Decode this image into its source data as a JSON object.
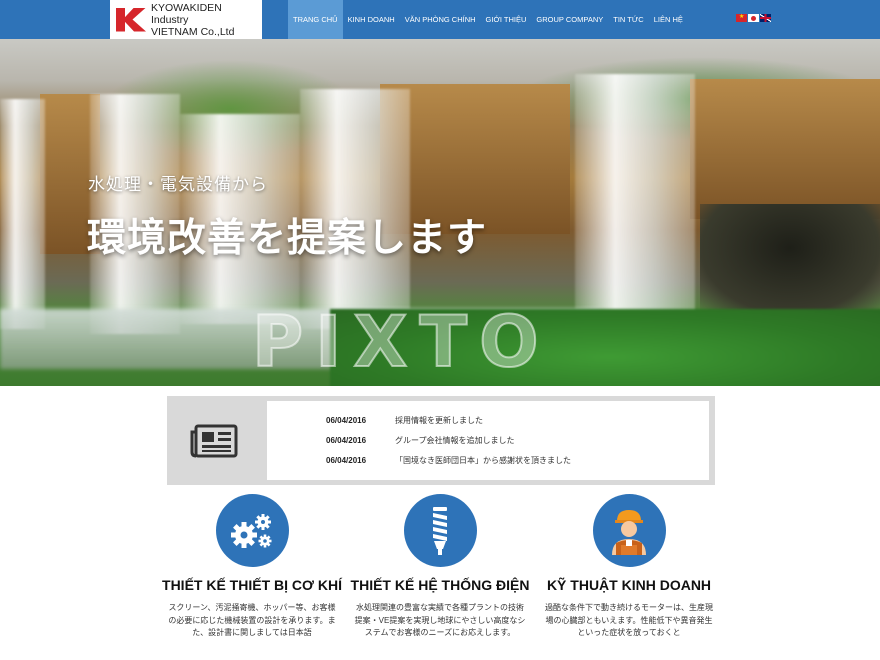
{
  "header": {
    "logo_line1": "KYOWAKIDEN Industry",
    "logo_line2": "VIETNAM Co.,Ltd",
    "nav": [
      {
        "label": "TRANG CHỦ",
        "active": true
      },
      {
        "label": "KINH DOANH",
        "active": false
      },
      {
        "label": "VĂN PHÒNG CHÍNH",
        "active": false
      },
      {
        "label": "GIỚI THIỆU",
        "active": false
      },
      {
        "label": "GROUP COMPANY",
        "active": false
      },
      {
        "label": "TIN TỨC",
        "active": false
      },
      {
        "label": "LIÊN HỆ",
        "active": false
      }
    ],
    "flags": [
      "vietnam-flag-icon",
      "japan-flag-icon",
      "uk-flag-icon"
    ]
  },
  "hero": {
    "subtitle": "水処理・電気設備から",
    "title": "環境改善を提案します",
    "watermark": "PIXTO"
  },
  "news": {
    "icon": "newspaper-icon",
    "items": [
      {
        "date": "06/04/2016",
        "text": "採用情報を更新しました"
      },
      {
        "date": "06/04/2016",
        "text": "グループ会社情報を追加しました"
      },
      {
        "date": "06/04/2016",
        "text": "「国境なき医師団日本」から感謝状を頂きました"
      }
    ]
  },
  "services": [
    {
      "icon": "gears-icon",
      "title": "THIẾT KẾ THIẾT BỊ CƠ KHÍ",
      "desc": "スクリーン、汚泥掻寄機、ホッパー等、お客様の必要に応じた機械装置の設計を承ります。また、設計書に関しましては日本語"
    },
    {
      "icon": "light-bulb-icon",
      "title": "THIẾT KẾ HỆ THỐNG ĐIỆN",
      "desc": "水処理関連の豊富な実績で各種プラントの技術提案・VE提案を実現し地球にやさしい高度なシステムでお客様のニーズにお応えします。"
    },
    {
      "icon": "engineer-icon",
      "title": "KỸ THUẬT KINH DOANH",
      "desc": "過酷な条件下で動き続けるモーターは、生産現場の心臓部ともいえます。性能低下や異音発生といった症状を放っておくと"
    }
  ],
  "colors": {
    "brand_blue": "#2e73b8",
    "nav_active": "#5b9bd5",
    "logo_red": "#d6262b"
  }
}
